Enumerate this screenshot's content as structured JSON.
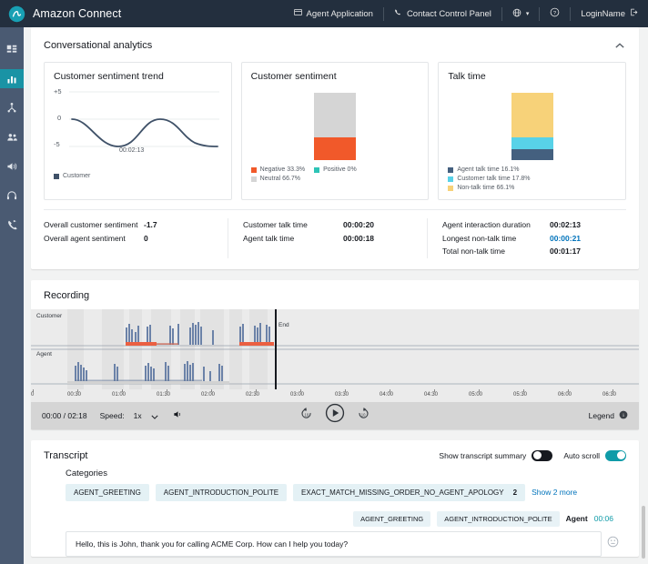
{
  "topnav": {
    "app_title": "Amazon Connect",
    "logo_icon": "amazon-connect-logo",
    "items": [
      {
        "label": "Agent Application",
        "icon": "window-icon"
      },
      {
        "label": "Contact Control Panel",
        "icon": "phone-icon"
      }
    ],
    "language_icon": "globe-icon",
    "language_caret": "▾",
    "help_icon": "question-circle-icon",
    "user_label": "LoginName",
    "signout_icon": "sign-out-icon"
  },
  "sidebar": {
    "items": [
      {
        "name": "dashboard",
        "icon": "dashboard-icon",
        "active": false
      },
      {
        "name": "analytics",
        "icon": "bar-chart-icon",
        "active": true
      },
      {
        "name": "routing",
        "icon": "routing-icon",
        "active": false
      },
      {
        "name": "users",
        "icon": "users-icon",
        "active": false
      },
      {
        "name": "campaigns",
        "icon": "megaphone-icon",
        "active": false
      },
      {
        "name": "agent-status",
        "icon": "headset-icon",
        "active": false
      },
      {
        "name": "phone-numbers",
        "icon": "phone-forward-icon",
        "active": false
      }
    ]
  },
  "analytics": {
    "title": "Conversational analytics",
    "collapse_icon": "chevron-up-icon",
    "metrics": [
      {
        "label": "Overall customer sentiment",
        "value": "-1.7",
        "link": false
      },
      {
        "label": "Overall agent sentiment",
        "value": "0",
        "link": false
      },
      {
        "label": "Customer talk time",
        "value": "00:00:20",
        "link": false
      },
      {
        "label": "Agent talk time",
        "value": "00:00:18",
        "link": false
      },
      {
        "label": "Agent interaction duration",
        "value": "00:02:13",
        "link": false
      },
      {
        "label": "Longest non-talk time",
        "value": "00:00:21",
        "link": true
      },
      {
        "label": "Total non-talk time",
        "value": "00:01:17",
        "link": false
      }
    ]
  },
  "chart_data": [
    {
      "type": "line",
      "title": "Customer sentiment trend",
      "xlabel": "",
      "ylabel": "",
      "ylim": [
        -5,
        5
      ],
      "ytick_labels": [
        "+5",
        "0",
        "-5"
      ],
      "xtick_labels": [
        "00:02:13"
      ],
      "series": [
        {
          "name": "Customer",
          "color": "#3f5168",
          "x": [
            0,
            0.12,
            0.25,
            0.38,
            0.5,
            0.62,
            0.75,
            0.88,
            1.0
          ],
          "values": [
            0,
            -2.0,
            -4.1,
            -5.0,
            -4.0,
            -1.5,
            0.1,
            -2.0,
            -5.0
          ]
        }
      ],
      "legend": [
        {
          "label": "Customer",
          "color": "#3f5168"
        }
      ],
      "grid": true
    },
    {
      "type": "bar",
      "title": "Customer sentiment",
      "stacked": true,
      "categories": [
        "Customer sentiment"
      ],
      "series": [
        {
          "name": "Neutral 66.7%",
          "values": [
            66.7
          ],
          "color": "#d5d5d5"
        },
        {
          "name": "Negative 33.3%",
          "values": [
            33.3
          ],
          "color": "#f1592a"
        },
        {
          "name": "Positive 0%",
          "values": [
            0
          ],
          "color": "#2ec4b6"
        }
      ],
      "legend": [
        {
          "label": "Negative 33.3%",
          "color": "#f1592a"
        },
        {
          "label": "Positive 0%",
          "color": "#2ec4b6"
        },
        {
          "label": "Neutral 66.7%",
          "color": "#d5d5d5"
        }
      ]
    },
    {
      "type": "bar",
      "title": "Talk time",
      "stacked": true,
      "categories": [
        "Talk time"
      ],
      "series": [
        {
          "name": "Non-talk time 66.1%",
          "values": [
            66.1
          ],
          "color": "#f7d279"
        },
        {
          "name": "Customer talk time 17.8%",
          "values": [
            17.8
          ],
          "color": "#58d2e8"
        },
        {
          "name": "Agent talk time 16.1%",
          "values": [
            16.1
          ],
          "color": "#44607f"
        }
      ],
      "legend": [
        {
          "label": "Agent talk time 16.1%",
          "color": "#44607f"
        },
        {
          "label": "Customer talk time 17.8%",
          "color": "#44607f"
        },
        {
          "label": "Non-talk time 66.1%",
          "color": "#f7d279"
        }
      ]
    }
  ],
  "recording": {
    "title": "Recording",
    "customer_label": "Customer",
    "agent_label": "Agent",
    "end_label": "End",
    "axis_ticks": [
      "0",
      "00:30",
      "01:00",
      "01:30",
      "02:00",
      "02:30",
      "03:00",
      "03:30",
      "04:00",
      "04:30",
      "05:00",
      "05:30",
      "06:00",
      "06:30"
    ],
    "time_display": "00:00 / 02:18",
    "speed_label": "Speed:",
    "speed_value": "1x",
    "speed_caret": "▾",
    "volume_icon": "volume-icon",
    "rewind_icon": "rewind-10-icon",
    "play_icon": "play-icon",
    "forward_icon": "forward-10-icon",
    "legend_label": "Legend",
    "legend_info_icon": "info-icon"
  },
  "transcript": {
    "title": "Transcript",
    "show_summary_label": "Show transcript summary",
    "show_summary_on": false,
    "auto_scroll_label": "Auto scroll",
    "auto_scroll_on": true,
    "categories_label": "Categories",
    "categories": [
      {
        "label": "AGENT_GREETING",
        "count": ""
      },
      {
        "label": "AGENT_INTRODUCTION_POLITE",
        "count": ""
      },
      {
        "label": "EXACT_MATCH_MISSING_ORDER_NO_AGENT_APOLOGY",
        "count": "2"
      }
    ],
    "show_more": "Show 2 more",
    "message": {
      "tags": [
        "AGENT_GREETING",
        "AGENT_INTRODUCTION_POLITE"
      ],
      "speaker": "Agent",
      "time": "00:06",
      "text": "Hello, this is John, thank you for calling ACME Corp. How can I help you today?",
      "sentiment_icon": "neutral-face-icon"
    }
  }
}
